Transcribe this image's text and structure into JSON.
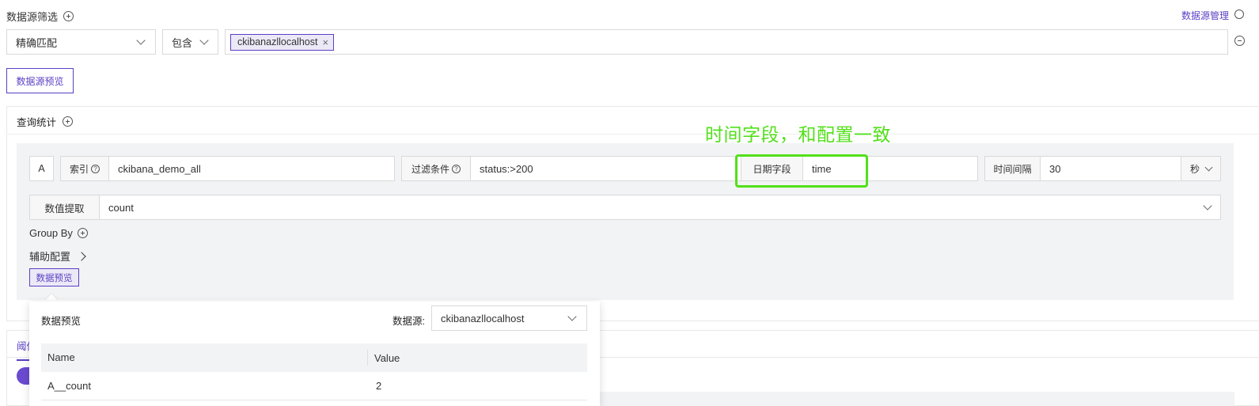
{
  "filter": {
    "title": "数据源筛选",
    "manage_link": "数据源管理",
    "match_mode": "精确匹配",
    "operator": "包含",
    "tag": "ckibanazllocalhost",
    "preview_button": "数据源预览"
  },
  "query": {
    "title": "查询统计",
    "row_label": "A",
    "index_label": "索引",
    "index_value": "ckibana_demo_all",
    "filter_label": "过滤条件",
    "filter_value": "status:>200",
    "date_field_label": "日期字段",
    "date_field_value": "time",
    "interval_label": "时间间隔",
    "interval_value": "30",
    "interval_unit": "秒",
    "extract_label": "数值提取",
    "extract_value": "count",
    "group_by": "Group By",
    "aux_config": "辅助配置",
    "data_preview_button": "数据预览"
  },
  "annotation": {
    "text": "时间字段，和配置一致",
    "color": "#52e01a"
  },
  "threshold_tab_partial": "阈值",
  "popover": {
    "title": "数据预览",
    "source_label": "数据源:",
    "source_value": "ckibanazllocalhost",
    "columns": [
      "Name",
      "Value"
    ],
    "rows": [
      [
        "A__count",
        "2"
      ]
    ]
  },
  "colors": {
    "accent": "#5b3fc4",
    "panel_bg": "#f2f3f5"
  }
}
